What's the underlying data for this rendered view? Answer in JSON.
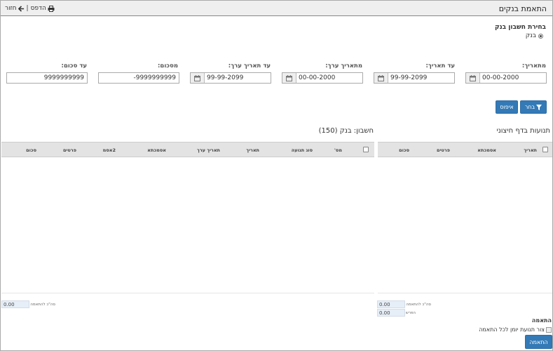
{
  "window": {
    "title": "התאמת בנקים",
    "print_label": "הדפס",
    "back_label": "חזור",
    "separator": "|"
  },
  "bank_selection": {
    "title": "בחירת חשבון בנק",
    "option": "בנק"
  },
  "filters": {
    "from_date": {
      "label": "מתאריך:",
      "value": "00-00-2000"
    },
    "to_date": {
      "label": "עד תאריך:",
      "value": "99-99-2099"
    },
    "from_value_date": {
      "label": "מתאריך ערך:",
      "value": "00-00-2000"
    },
    "to_value_date": {
      "label": "עד תאריך ערך:",
      "value": "99-99-2099"
    },
    "from_amount": {
      "label": "מסכום:",
      "value": "-9999999999"
    },
    "to_amount": {
      "label": "עד סכום:",
      "value": "9999999999"
    }
  },
  "buttons": {
    "select_label": "בחר",
    "reset_label": "איפוס"
  },
  "right_grid": {
    "title": "תנועות בדף חיצוני",
    "columns": [
      "תאריך",
      "אסמכתא",
      "פרטים",
      "סכום"
    ],
    "sum_to_match_label": "סה\"כ להתאמה",
    "sum_to_match_value": "0.00",
    "diff_label": "הפרש",
    "diff_value": "0.00"
  },
  "left_grid": {
    "title": "חשבון: בנק (150)",
    "columns": [
      "מס'",
      "סוג תנועה",
      "תאריך",
      "תאריך ערך",
      "אסמכתא",
      "2אסמ",
      "פרטים",
      "סכום"
    ],
    "sum_to_match_label": "סה\"כ להתאמה",
    "sum_to_match_value": "0.00"
  },
  "match": {
    "title": "התאמה",
    "checkbox_label": "צור תנועת יומן לכל התאמה",
    "button_label": "התאמה"
  },
  "colors": {
    "primary_button": "#337ab7",
    "header_bg": "#e3e3e3",
    "sum_box_bg": "#e6eef7"
  }
}
